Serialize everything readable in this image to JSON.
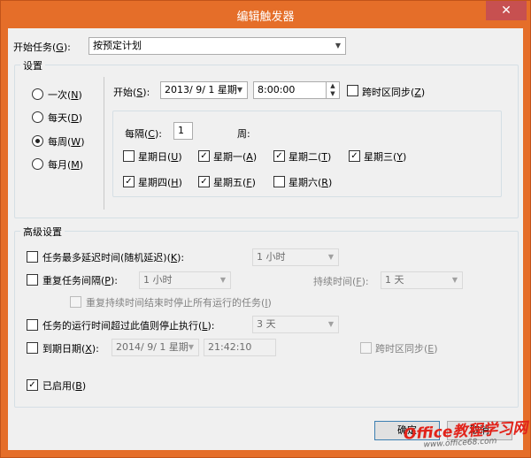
{
  "window": {
    "title": "编辑触发器",
    "close_icon": "close-icon"
  },
  "begin_task": {
    "label": "开始任务(",
    "accel": "G",
    "suffix": "):",
    "value": "按预定计划"
  },
  "settings": {
    "group_label": "设置",
    "schedule_options": [
      {
        "label": "一次(",
        "accel": "N",
        "suffix": ")",
        "selected": false
      },
      {
        "label": "每天(",
        "accel": "D",
        "suffix": ")",
        "selected": false
      },
      {
        "label": "每周(",
        "accel": "W",
        "suffix": ")",
        "selected": true
      },
      {
        "label": "每月(",
        "accel": "M",
        "suffix": ")",
        "selected": false
      }
    ],
    "start": {
      "label": "开始(",
      "accel": "S",
      "suffix": "):",
      "date": "2013/  9/  1 星期",
      "time": "8:00:00",
      "sync_label": "跨时区同步(",
      "sync_accel": "Z",
      "sync_suffix": ")",
      "sync_checked": false
    },
    "weekly": {
      "recur_label": "每隔(",
      "recur_accel": "C",
      "recur_suffix": "):",
      "recur_value": "1",
      "weeks_label": "周:",
      "days": [
        {
          "label": "星期日(",
          "accel": "U",
          "suffix": ")",
          "checked": false
        },
        {
          "label": "星期一(",
          "accel": "A",
          "suffix": ")",
          "checked": true
        },
        {
          "label": "星期二(",
          "accel": "T",
          "suffix": ")",
          "checked": true
        },
        {
          "label": "星期三(",
          "accel": "Y",
          "suffix": ")",
          "checked": true
        },
        {
          "label": "星期四(",
          "accel": "H",
          "suffix": ")",
          "checked": true
        },
        {
          "label": "星期五(",
          "accel": "F",
          "suffix": ")",
          "checked": true
        },
        {
          "label": "星期六(",
          "accel": "R",
          "suffix": ")",
          "checked": false
        }
      ]
    }
  },
  "advanced": {
    "group_label": "高级设置",
    "delay": {
      "label": "任务最多延迟时间(随机延迟)(",
      "accel": "K",
      "suffix": "):",
      "value": "1 小时",
      "checked": false
    },
    "repeat": {
      "label": "重复任务间隔(",
      "accel": "P",
      "suffix": "):",
      "value": "1 小时",
      "checked": false,
      "duration_label": "持续时间(",
      "duration_accel": "F",
      "duration_suffix": "):",
      "duration_value": "1 天"
    },
    "stop_running": {
      "label": "重复持续时间结束时停止所有运行的任务(",
      "accel": "I",
      "suffix": ")",
      "checked": false
    },
    "stop_longer": {
      "label": "任务的运行时间超过此值则停止执行(",
      "accel": "L",
      "suffix": "):",
      "value": "3 天",
      "checked": false
    },
    "expire": {
      "label": "到期日期(",
      "accel": "X",
      "suffix": "):",
      "date": "2014/  9/  1 星期",
      "time": "21:42:10",
      "checked": false,
      "sync_label": "跨时区同步(",
      "sync_accel": "E",
      "sync_suffix": ")"
    },
    "enabled": {
      "label": "已启用(",
      "accel": "B",
      "suffix": ")",
      "checked": true
    }
  },
  "buttons": {
    "ok": "确定",
    "cancel": "取消"
  },
  "watermark": {
    "brand": "Office教程学习网",
    "url": "www.office68.com"
  }
}
